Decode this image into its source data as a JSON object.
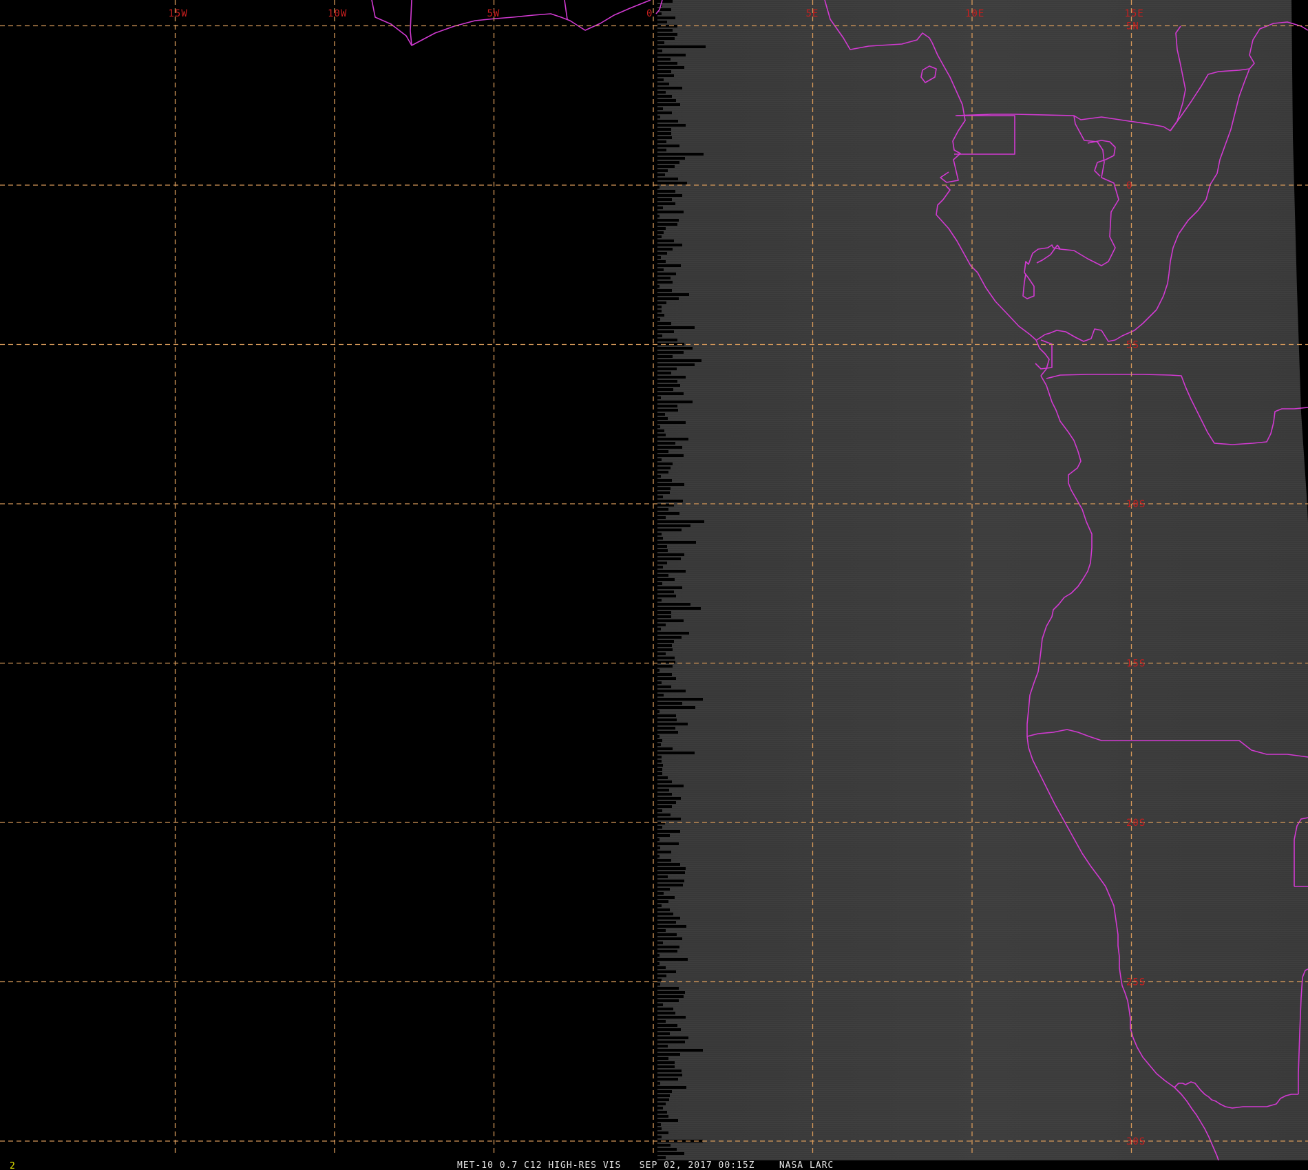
{
  "footer": {
    "frame_number": "2",
    "caption": "MET-10 0.7 C12 HIGH-RES VIS   SEP 02, 2017 00:15Z    NASA LARC"
  },
  "grid": {
    "longitudes": [
      {
        "label": "15W",
        "lon": -15
      },
      {
        "label": "10W",
        "lon": -10
      },
      {
        "label": "5W",
        "lon": -5
      },
      {
        "label": "0",
        "lon": 0
      },
      {
        "label": "5E",
        "lon": 5
      },
      {
        "label": "10E",
        "lon": 10
      },
      {
        "label": "15E",
        "lon": 15
      }
    ],
    "latitudes": [
      {
        "label": "5N",
        "lat": 5
      },
      {
        "label": "0",
        "lat": 0
      },
      {
        "label": "5S",
        "lat": -5
      },
      {
        "label": "10S",
        "lat": -10
      },
      {
        "label": "15S",
        "lat": -15
      },
      {
        "label": "20S",
        "lat": -20
      },
      {
        "label": "25S",
        "lat": -25
      },
      {
        "label": "30S",
        "lat": -30
      }
    ]
  },
  "colors": {
    "background": "#000000",
    "imagery_gray": "#3c3c3c",
    "grid_line": "#d89a5a",
    "grid_label": "#c81e1e",
    "borders": "#d23ad2",
    "caption": "#e6e6e6",
    "frame_number": "#e8e800"
  }
}
